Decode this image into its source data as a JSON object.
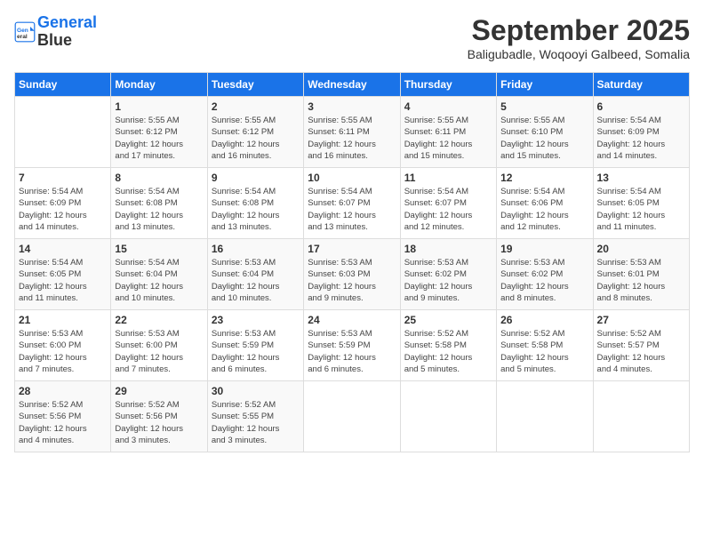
{
  "logo": {
    "line1": "General",
    "line2": "Blue"
  },
  "title": "September 2025",
  "subtitle": "Baligubadle, Woqooyi Galbeed, Somalia",
  "days_of_week": [
    "Sunday",
    "Monday",
    "Tuesday",
    "Wednesday",
    "Thursday",
    "Friday",
    "Saturday"
  ],
  "weeks": [
    [
      {
        "day": "",
        "info": ""
      },
      {
        "day": "1",
        "info": "Sunrise: 5:55 AM\nSunset: 6:12 PM\nDaylight: 12 hours\nand 17 minutes."
      },
      {
        "day": "2",
        "info": "Sunrise: 5:55 AM\nSunset: 6:12 PM\nDaylight: 12 hours\nand 16 minutes."
      },
      {
        "day": "3",
        "info": "Sunrise: 5:55 AM\nSunset: 6:11 PM\nDaylight: 12 hours\nand 16 minutes."
      },
      {
        "day": "4",
        "info": "Sunrise: 5:55 AM\nSunset: 6:11 PM\nDaylight: 12 hours\nand 15 minutes."
      },
      {
        "day": "5",
        "info": "Sunrise: 5:55 AM\nSunset: 6:10 PM\nDaylight: 12 hours\nand 15 minutes."
      },
      {
        "day": "6",
        "info": "Sunrise: 5:54 AM\nSunset: 6:09 PM\nDaylight: 12 hours\nand 14 minutes."
      }
    ],
    [
      {
        "day": "7",
        "info": "Sunrise: 5:54 AM\nSunset: 6:09 PM\nDaylight: 12 hours\nand 14 minutes."
      },
      {
        "day": "8",
        "info": "Sunrise: 5:54 AM\nSunset: 6:08 PM\nDaylight: 12 hours\nand 13 minutes."
      },
      {
        "day": "9",
        "info": "Sunrise: 5:54 AM\nSunset: 6:08 PM\nDaylight: 12 hours\nand 13 minutes."
      },
      {
        "day": "10",
        "info": "Sunrise: 5:54 AM\nSunset: 6:07 PM\nDaylight: 12 hours\nand 13 minutes."
      },
      {
        "day": "11",
        "info": "Sunrise: 5:54 AM\nSunset: 6:07 PM\nDaylight: 12 hours\nand 12 minutes."
      },
      {
        "day": "12",
        "info": "Sunrise: 5:54 AM\nSunset: 6:06 PM\nDaylight: 12 hours\nand 12 minutes."
      },
      {
        "day": "13",
        "info": "Sunrise: 5:54 AM\nSunset: 6:05 PM\nDaylight: 12 hours\nand 11 minutes."
      }
    ],
    [
      {
        "day": "14",
        "info": "Sunrise: 5:54 AM\nSunset: 6:05 PM\nDaylight: 12 hours\nand 11 minutes."
      },
      {
        "day": "15",
        "info": "Sunrise: 5:54 AM\nSunset: 6:04 PM\nDaylight: 12 hours\nand 10 minutes."
      },
      {
        "day": "16",
        "info": "Sunrise: 5:53 AM\nSunset: 6:04 PM\nDaylight: 12 hours\nand 10 minutes."
      },
      {
        "day": "17",
        "info": "Sunrise: 5:53 AM\nSunset: 6:03 PM\nDaylight: 12 hours\nand 9 minutes."
      },
      {
        "day": "18",
        "info": "Sunrise: 5:53 AM\nSunset: 6:02 PM\nDaylight: 12 hours\nand 9 minutes."
      },
      {
        "day": "19",
        "info": "Sunrise: 5:53 AM\nSunset: 6:02 PM\nDaylight: 12 hours\nand 8 minutes."
      },
      {
        "day": "20",
        "info": "Sunrise: 5:53 AM\nSunset: 6:01 PM\nDaylight: 12 hours\nand 8 minutes."
      }
    ],
    [
      {
        "day": "21",
        "info": "Sunrise: 5:53 AM\nSunset: 6:00 PM\nDaylight: 12 hours\nand 7 minutes."
      },
      {
        "day": "22",
        "info": "Sunrise: 5:53 AM\nSunset: 6:00 PM\nDaylight: 12 hours\nand 7 minutes."
      },
      {
        "day": "23",
        "info": "Sunrise: 5:53 AM\nSunset: 5:59 PM\nDaylight: 12 hours\nand 6 minutes."
      },
      {
        "day": "24",
        "info": "Sunrise: 5:53 AM\nSunset: 5:59 PM\nDaylight: 12 hours\nand 6 minutes."
      },
      {
        "day": "25",
        "info": "Sunrise: 5:52 AM\nSunset: 5:58 PM\nDaylight: 12 hours\nand 5 minutes."
      },
      {
        "day": "26",
        "info": "Sunrise: 5:52 AM\nSunset: 5:58 PM\nDaylight: 12 hours\nand 5 minutes."
      },
      {
        "day": "27",
        "info": "Sunrise: 5:52 AM\nSunset: 5:57 PM\nDaylight: 12 hours\nand 4 minutes."
      }
    ],
    [
      {
        "day": "28",
        "info": "Sunrise: 5:52 AM\nSunset: 5:56 PM\nDaylight: 12 hours\nand 4 minutes."
      },
      {
        "day": "29",
        "info": "Sunrise: 5:52 AM\nSunset: 5:56 PM\nDaylight: 12 hours\nand 3 minutes."
      },
      {
        "day": "30",
        "info": "Sunrise: 5:52 AM\nSunset: 5:55 PM\nDaylight: 12 hours\nand 3 minutes."
      },
      {
        "day": "",
        "info": ""
      },
      {
        "day": "",
        "info": ""
      },
      {
        "day": "",
        "info": ""
      },
      {
        "day": "",
        "info": ""
      }
    ]
  ]
}
